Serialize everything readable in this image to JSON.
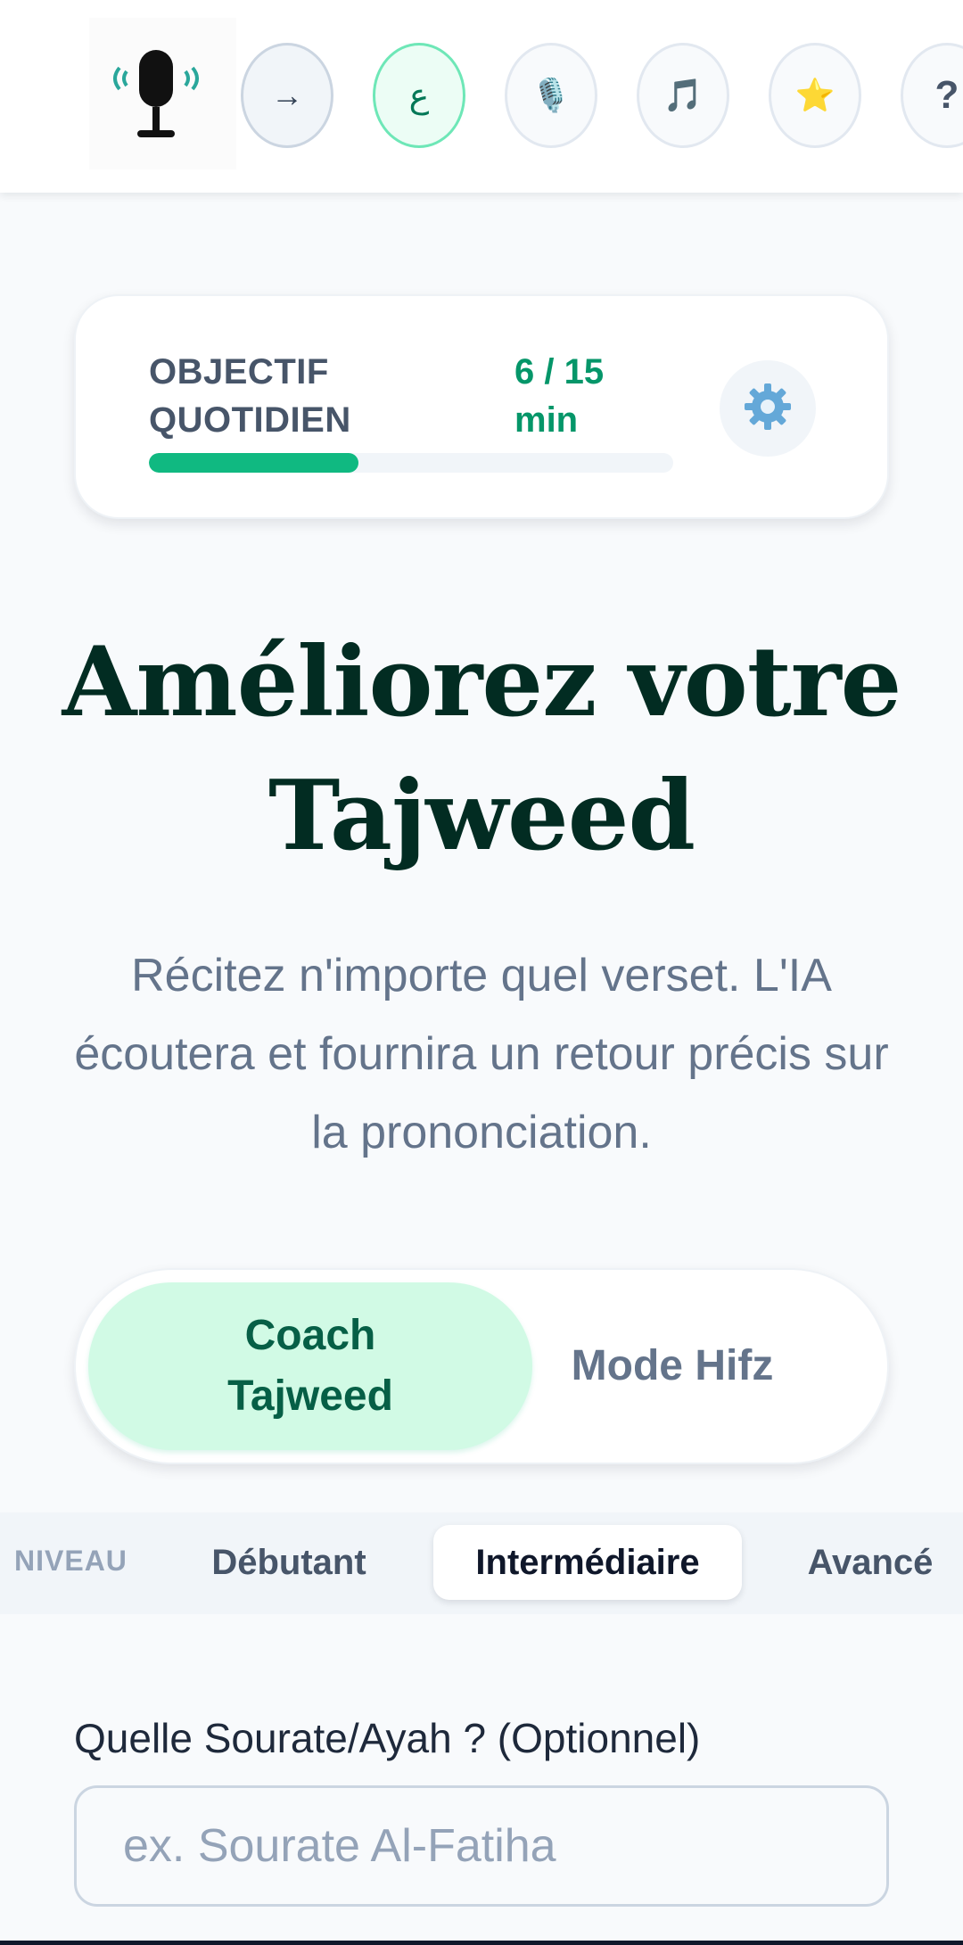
{
  "topbar": {
    "logo_icon": "microphone-broadcast-icon",
    "buttons": [
      {
        "name": "arrow-button",
        "icon": "arrow-right-icon",
        "glyph": "→"
      },
      {
        "name": "arabic-button",
        "icon": "arabic-letter-icon",
        "glyph": "ع"
      },
      {
        "name": "microphone-button",
        "icon": "studio-microphone-icon",
        "glyph": "🎙️"
      },
      {
        "name": "music-button",
        "icon": "music-notes-icon",
        "glyph": "🎵"
      },
      {
        "name": "favorites-button",
        "icon": "star-icon",
        "glyph": "⭐"
      },
      {
        "name": "help-button",
        "icon": "question-mark-icon",
        "glyph": "?"
      }
    ]
  },
  "goal": {
    "label": "OBJECTIF QUOTIDIEN",
    "value": "6 / 15 min",
    "progress_fraction": 0.4,
    "settings_icon": "gear-icon"
  },
  "hero": {
    "title": "Améliorez votre Tajweed",
    "subtitle": "Récitez n'importe quel verset. L'IA écoutera et fournira un retour précis sur la prononciation."
  },
  "modes": {
    "coach": "Coach Tajweed",
    "hifz": "Mode Hifz",
    "selected": "coach"
  },
  "level": {
    "label": "NIVEAU",
    "options": [
      "Débutant",
      "Intermédiaire",
      "Avancé"
    ],
    "selected": "Intermédiaire"
  },
  "surah_input": {
    "label": "Quelle Sourate/Ayah ? (Optionnel)",
    "placeholder": "ex. Sourate Al-Fatiha",
    "value": ""
  },
  "colors": {
    "accent": "#10b981",
    "accent_dark": "#065f46",
    "title": "#022c22",
    "muted": "#64748b"
  }
}
